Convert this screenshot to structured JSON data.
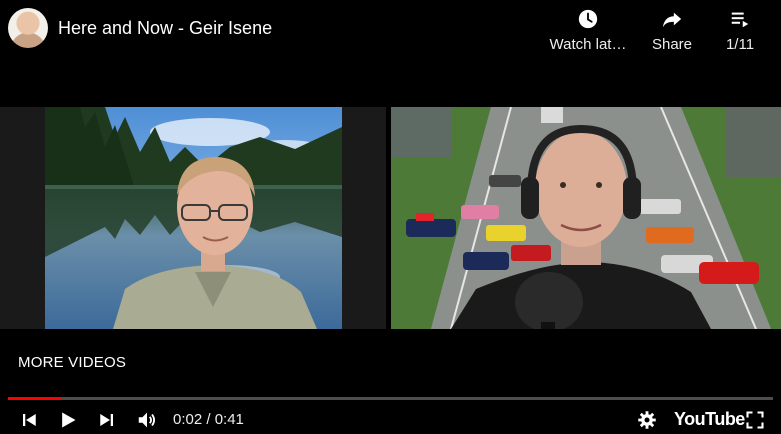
{
  "header": {
    "title": "Here and Now - Geir Isene",
    "actions": [
      {
        "label": "Watch lat…",
        "icon": "clock-icon"
      },
      {
        "label": "Share",
        "icon": "share-icon"
      },
      {
        "label": "1/11",
        "icon": "playlist-icon"
      }
    ]
  },
  "more_videos_label": "MORE VIDEOS",
  "controls": {
    "time_display": "0:02 / 0:41",
    "progress_fraction": 0.07,
    "logo_text": "YouTube"
  },
  "colors": {
    "progress": "#ff0000",
    "background": "#000000"
  }
}
